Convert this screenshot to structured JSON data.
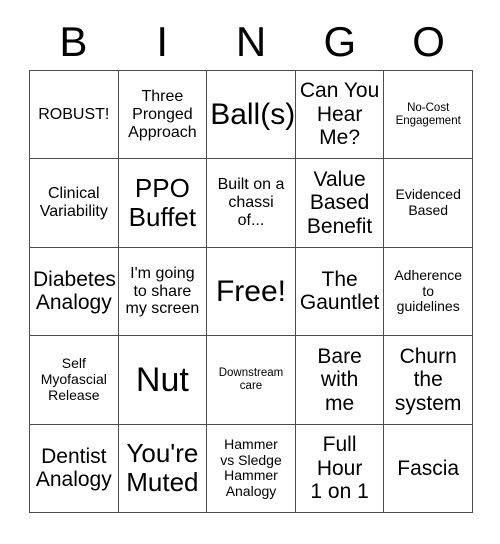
{
  "card": {
    "title": "BINGO",
    "header_letters": [
      "B",
      "I",
      "N",
      "G",
      "O"
    ],
    "colors": {
      "background": "#ffffff",
      "text": "#000000",
      "grid_line": "#4d4d4d"
    },
    "rows": [
      [
        {
          "text": "ROBUST!",
          "size": "sm"
        },
        {
          "text": "Three\nPronged\nApproach",
          "size": "sm"
        },
        {
          "text": "Ball(s)",
          "size": "xl"
        },
        {
          "text": "Can You\nHear\nMe?",
          "size": "md"
        },
        {
          "text": "No-Cost\nEngagement",
          "size": "xxs"
        }
      ],
      [
        {
          "text": "Clinical\nVariability",
          "size": "sm"
        },
        {
          "text": "PPO\nBuffet",
          "size": "lg"
        },
        {
          "text": "Built on a\nchassi\nof...",
          "size": "sm"
        },
        {
          "text": "Value\nBased\nBenefit",
          "size": "md"
        },
        {
          "text": "Evidenced\nBased",
          "size": "xs"
        }
      ],
      [
        {
          "text": "Diabetes\nAnalogy",
          "size": "md"
        },
        {
          "text": "I'm going\nto share\nmy screen",
          "size": "sm"
        },
        {
          "text": "Free!",
          "size": "xl"
        },
        {
          "text": "The\nGauntlet",
          "size": "md"
        },
        {
          "text": "Adherence\nto\nguidelines",
          "size": "xs"
        }
      ],
      [
        {
          "text": "Self\nMyofascial\nRelease",
          "size": "xs"
        },
        {
          "text": "Nut",
          "size": "xxl"
        },
        {
          "text": "Downstream\ncare",
          "size": "xxs"
        },
        {
          "text": "Bare\nwith\nme",
          "size": "md"
        },
        {
          "text": "Churn\nthe\nsystem",
          "size": "md"
        }
      ],
      [
        {
          "text": "Dentist\nAnalogy",
          "size": "md"
        },
        {
          "text": "You're\nMuted",
          "size": "lg"
        },
        {
          "text": "Hammer\nvs Sledge\nHammer\nAnalogy",
          "size": "xs"
        },
        {
          "text": "Full\nHour\n1 on 1",
          "size": "md"
        },
        {
          "text": "Fascia",
          "size": "md"
        }
      ]
    ]
  }
}
